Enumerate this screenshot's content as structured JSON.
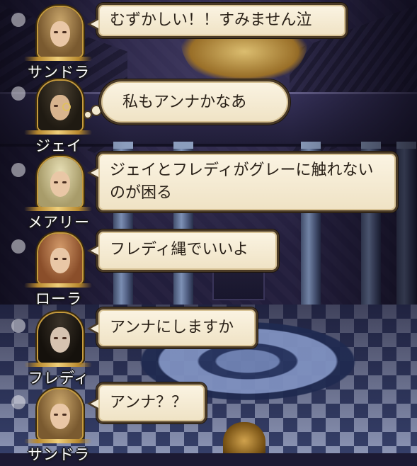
{
  "messages": [
    {
      "speaker": "サンドラ",
      "text": "むずかしい！！すみません泣",
      "style": "speech",
      "avatar_icon": "sandra-portrait-icon"
    },
    {
      "speaker": "ジェイ",
      "text": "私もアンナかなあ",
      "style": "thought",
      "avatar_icon": "jay-portrait-icon"
    },
    {
      "speaker": "メアリー",
      "text": "ジェイとフレディがグレーに触れないのが困る",
      "style": "speech",
      "avatar_icon": "mary-portrait-icon"
    },
    {
      "speaker": "ローラ",
      "text": "フレディ縄でいいよ",
      "style": "speech",
      "avatar_icon": "laura-portrait-icon"
    },
    {
      "speaker": "フレディ",
      "text": "アンナにしますか",
      "style": "speech",
      "avatar_icon": "freddie-portrait-icon"
    },
    {
      "speaker": "サンドラ",
      "text": "アンナ？？",
      "style": "speech",
      "avatar_icon": "sandra-portrait-icon"
    }
  ],
  "colors": {
    "bubble_fill": "#f7eed9",
    "bubble_border": "#4a3a26",
    "frame_gold": "#c59a3c",
    "name_text": "#ffffff"
  }
}
